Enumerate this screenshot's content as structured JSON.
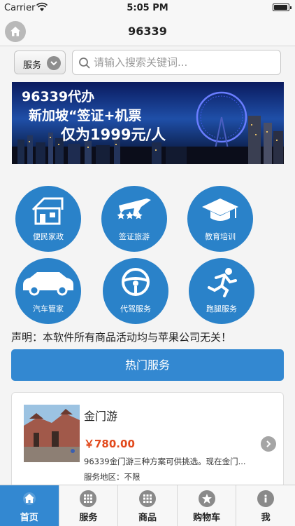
{
  "status_bar": {
    "carrier": "Carrier",
    "time": "5:05 PM"
  },
  "nav": {
    "title": "96339",
    "home_icon": "home-icon"
  },
  "search": {
    "category": "服务",
    "placeholder": "请输入搜索关键词..."
  },
  "banner": {
    "line1": "96339代办",
    "line2": "新加坡“签证+机票",
    "line3": "仅为1999元/人"
  },
  "services": [
    {
      "label": "便民家政",
      "icon": "house-icon"
    },
    {
      "label": "签证旅游",
      "icon": "airplane-icon"
    },
    {
      "label": "教育培训",
      "icon": "graduation-cap-icon"
    },
    {
      "label": "汽车管家",
      "icon": "car-icon"
    },
    {
      "label": "代驾服务",
      "icon": "steering-wheel-icon"
    },
    {
      "label": "跑腿服务",
      "icon": "running-person-icon"
    }
  ],
  "notice": "声明：本软件所有商品活动均与苹果公司无关！",
  "hot_services_button": "热门服务",
  "card": {
    "name": "金门游",
    "price": "￥780.00",
    "description": "96339金门游三种方案可供挑选。现在金门...",
    "area": "服务地区：不限"
  },
  "tabs": [
    {
      "label": "首页",
      "icon": "home-icon",
      "active": true
    },
    {
      "label": "服务",
      "icon": "grid-icon",
      "active": false
    },
    {
      "label": "商品",
      "icon": "grid-icon",
      "active": false
    },
    {
      "label": "购物车",
      "icon": "star-icon",
      "active": false
    },
    {
      "label": "我",
      "icon": "info-icon",
      "active": false
    }
  ],
  "colors": {
    "primary": "#2a82c9",
    "button": "#3388d1",
    "price": "#e24a1d"
  }
}
